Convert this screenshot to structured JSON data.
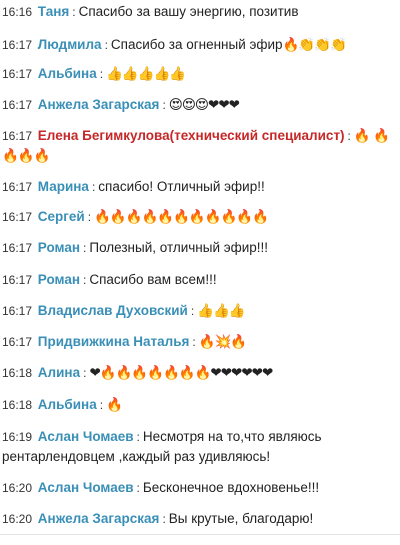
{
  "messages": [
    {
      "time": "16:16",
      "author": "Таня",
      "text": "Спасибо за вашу энергию, позитив",
      "emoji": ""
    },
    {
      "time": "16:17",
      "author": "Людмила",
      "text": "Спасибо за огненный эфир",
      "emoji": "🔥👏👏👏"
    },
    {
      "time": "16:17",
      "author": "Альбина",
      "text": "",
      "emoji": "👍👍👍👍👍"
    },
    {
      "time": "16:17",
      "author": "Анжела Загарская",
      "text": "",
      "emoji": "😍😍😍❤❤❤"
    },
    {
      "time": "16:17",
      "author": "Елена Бегимкулова(технический специалист)",
      "text": "",
      "emoji": "🔥 🔥🔥🔥🔥"
    },
    {
      "time": "16:17",
      "author": "Марина",
      "text": "спасибо! Отличный эфир!!",
      "emoji": ""
    },
    {
      "time": "16:17",
      "author": "Сергей",
      "text": "",
      "emoji": "🔥🔥🔥🔥🔥🔥🔥🔥🔥🔥🔥"
    },
    {
      "time": "16:17",
      "author": "Роман",
      "text": "Полезный, отличный эфир!!!",
      "emoji": ""
    },
    {
      "time": "16:17",
      "author": "Роман",
      "text": "Спасибо вам всем!!!",
      "emoji": ""
    },
    {
      "time": "16:17",
      "author": "Владислав Духовский",
      "text": "",
      "emoji": "👍👍👍"
    },
    {
      "time": "16:17",
      "author": "Придвижкина Наталья",
      "text": "",
      "emoji": "🔥💥🔥"
    },
    {
      "time": "16:18",
      "author": "Алина",
      "text": "",
      "emoji": "❤🔥🔥🔥🔥🔥🔥🔥❤❤❤❤❤❤"
    },
    {
      "time": "16:18",
      "author": "Альбина",
      "text": "",
      "emoji": "🔥"
    },
    {
      "time": "16:19",
      "author": "Аслан Чомаев",
      "text": "Несмотря на то,что являюсь рентарлендовцем ,каждый раз удивляюсь!",
      "emoji": ""
    },
    {
      "time": "16:20",
      "author": "Аслан Чомаев",
      "text": "Бесконечное вдохновенье!!!",
      "emoji": ""
    },
    {
      "time": "16:20",
      "author": "Анжела Загарская",
      "text": "Вы крутые, благодарю!",
      "emoji": ""
    }
  ],
  "separator": ":",
  "colors": {
    "author": "#3a8fb7",
    "author_highlight": "#c62828",
    "text": "#222222"
  }
}
